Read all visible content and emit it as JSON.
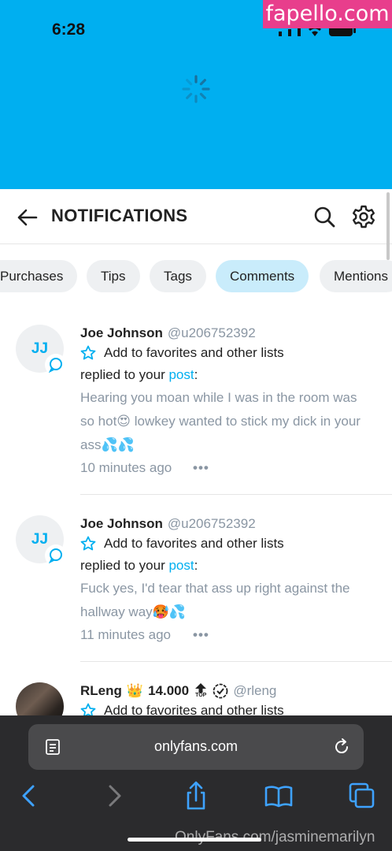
{
  "status_bar": {
    "time": "6:28"
  },
  "watermark_top": "fapello.com",
  "watermark_bottom": "OnlyFans.com/jasminemarilyn",
  "header": {
    "title": "NOTIFICATIONS"
  },
  "tabs": [
    {
      "label": "Purchases",
      "active": false
    },
    {
      "label": "Tips",
      "active": false
    },
    {
      "label": "Tags",
      "active": false
    },
    {
      "label": "Comments",
      "active": true
    },
    {
      "label": "Mentions",
      "active": false
    }
  ],
  "notifications": [
    {
      "avatar_initials": "JJ",
      "name": "Joe Johnson",
      "handle": "@u206752392",
      "favorites_label": "Add to favorites and other lists",
      "replied_prefix": "replied to your ",
      "replied_link": "post",
      "replied_suffix": ":",
      "message": "Hearing you moan while I was in the room was so hot😍 lowkey wanted to stick my dick in your ass💦💦",
      "time_ago": "10 minutes ago",
      "more": "•••"
    },
    {
      "avatar_initials": "JJ",
      "name": "Joe Johnson",
      "handle": "@u206752392",
      "favorites_label": "Add to favorites and other lists",
      "replied_prefix": "replied to your ",
      "replied_link": "post",
      "replied_suffix": ":",
      "message": "Fuck yes, I'd tear that ass up right against the hallway way🥵💦",
      "time_ago": "11 minutes ago",
      "more": "•••"
    },
    {
      "name": "RLeng",
      "crown": "👑",
      "score": "14.000",
      "top_label": "TOP",
      "handle": "@rleng",
      "favorites_label": "Add to favorites and other lists"
    }
  ],
  "browser": {
    "url": "onlyfans.com"
  },
  "colors": {
    "accent": "#00aff0",
    "status_bg": "#00aff0",
    "toolbar_bg": "#2b2b2d"
  }
}
